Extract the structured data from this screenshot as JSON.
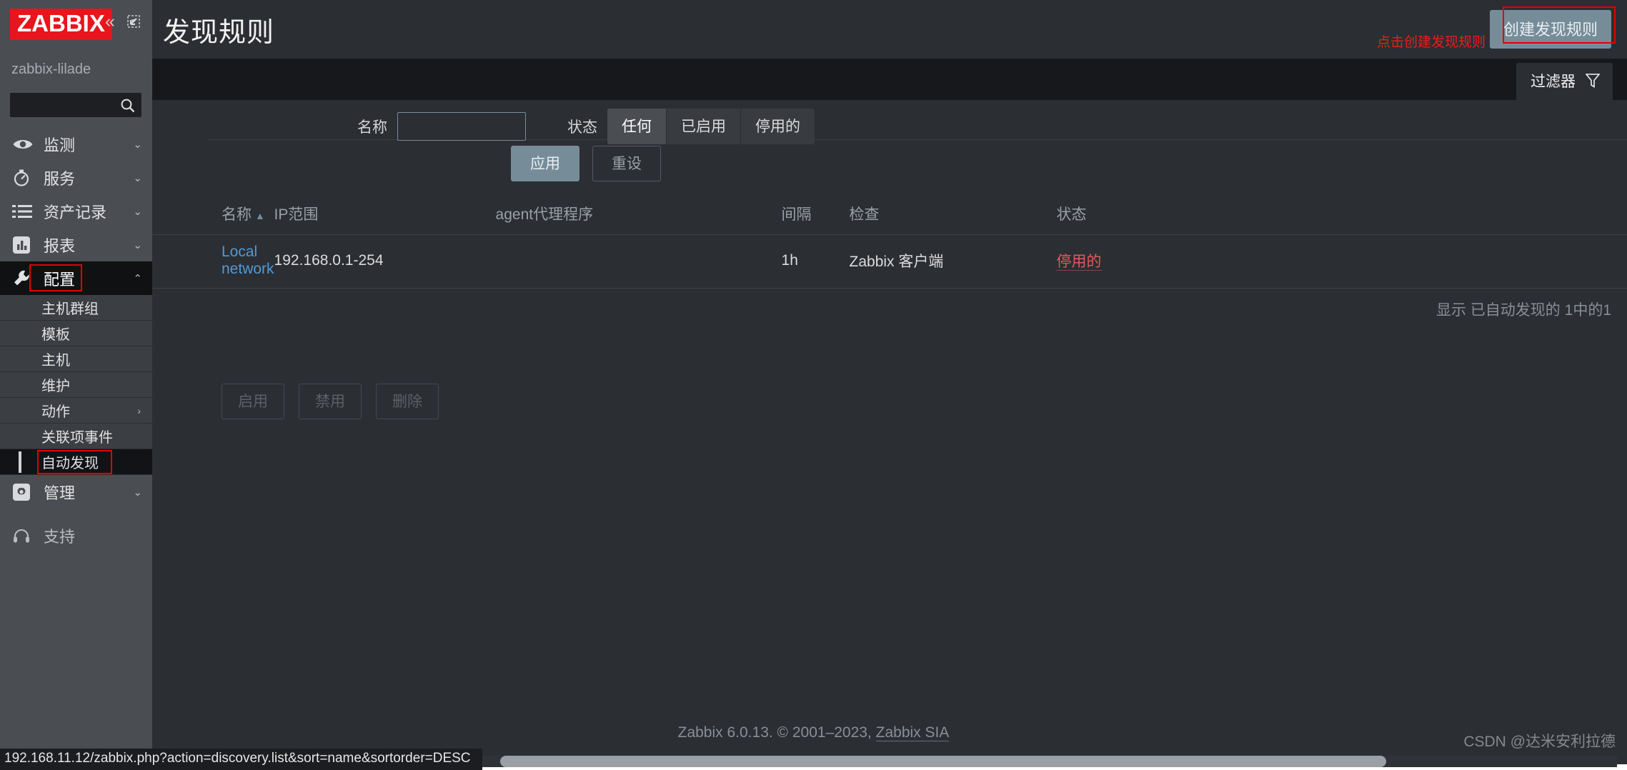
{
  "sidebar": {
    "logo": "ZABBIX",
    "collapse_icon": "chevrons-left-icon",
    "expand_icon": "expand-icon",
    "user": "zabbix-lilade",
    "search_value": "",
    "search_placeholder": "",
    "items": [
      {
        "label": "监测",
        "icon": "eye-icon",
        "chevron": "chevron-down"
      },
      {
        "label": "服务",
        "icon": "stopwatch-icon",
        "chevron": "chevron-down"
      },
      {
        "label": "资产记录",
        "icon": "list-icon",
        "chevron": "chevron-down"
      },
      {
        "label": "报表",
        "icon": "bar-chart-icon",
        "chevron": "chevron-down"
      },
      {
        "label": "配置",
        "icon": "wrench-icon",
        "chevron": "chevron-up",
        "active": true
      }
    ],
    "submenu": [
      {
        "label": "主机群组"
      },
      {
        "label": "模板"
      },
      {
        "label": "主机"
      },
      {
        "label": "维护"
      },
      {
        "label": "动作",
        "chevron": "chevron-right"
      },
      {
        "label": "关联项事件"
      },
      {
        "label": "自动发现",
        "selected": true
      }
    ],
    "bottom_items": [
      {
        "label": "管理",
        "icon": "gear-icon",
        "chevron": "chevron-down"
      },
      {
        "label": "支持",
        "icon": "headset-icon"
      }
    ]
  },
  "header": {
    "title": "发现规则",
    "create_button": "创建发现规则",
    "annotation": "点击创建发现规则"
  },
  "filter": {
    "tab_label": "过滤器",
    "tab_icon": "funnel-icon",
    "name_label": "名称",
    "name_value": "",
    "name_placeholder": "",
    "status_label": "状态",
    "status_options": [
      "任何",
      "已启用",
      "停用的"
    ],
    "status_selected": "任何",
    "apply_label": "应用",
    "reset_label": "重设"
  },
  "table": {
    "headers": [
      "名称",
      "IP范围",
      "agent代理程序",
      "间隔",
      "检查",
      "状态"
    ],
    "sort_column": "名称",
    "sort_direction": "asc",
    "sort_arrow": "▲",
    "rows": [
      {
        "name": "Local network",
        "ip_range": "192.168.0.1-254",
        "proxy": "",
        "interval": "1h",
        "checks": "Zabbix 客户端",
        "status": "停用的"
      }
    ],
    "paging": "显示 已自动发现的 1中的1",
    "bottom_actions": [
      "启用",
      "禁用",
      "删除"
    ]
  },
  "footer": {
    "text": "Zabbix 6.0.13. © 2001–2023, ",
    "link": "Zabbix SIA"
  },
  "statusbar": {
    "url": "192.168.11.12/zabbix.php?action=discovery.list&sort=name&sortorder=DESC"
  },
  "watermark": "CSDN @达米安利拉德",
  "colors": {
    "brand_red": "#e8141e",
    "accent_blue": "#4f9ad8",
    "status_red": "#e45959",
    "button_blue_gray": "#768d99",
    "annotation_red": "#ee1c1c"
  }
}
